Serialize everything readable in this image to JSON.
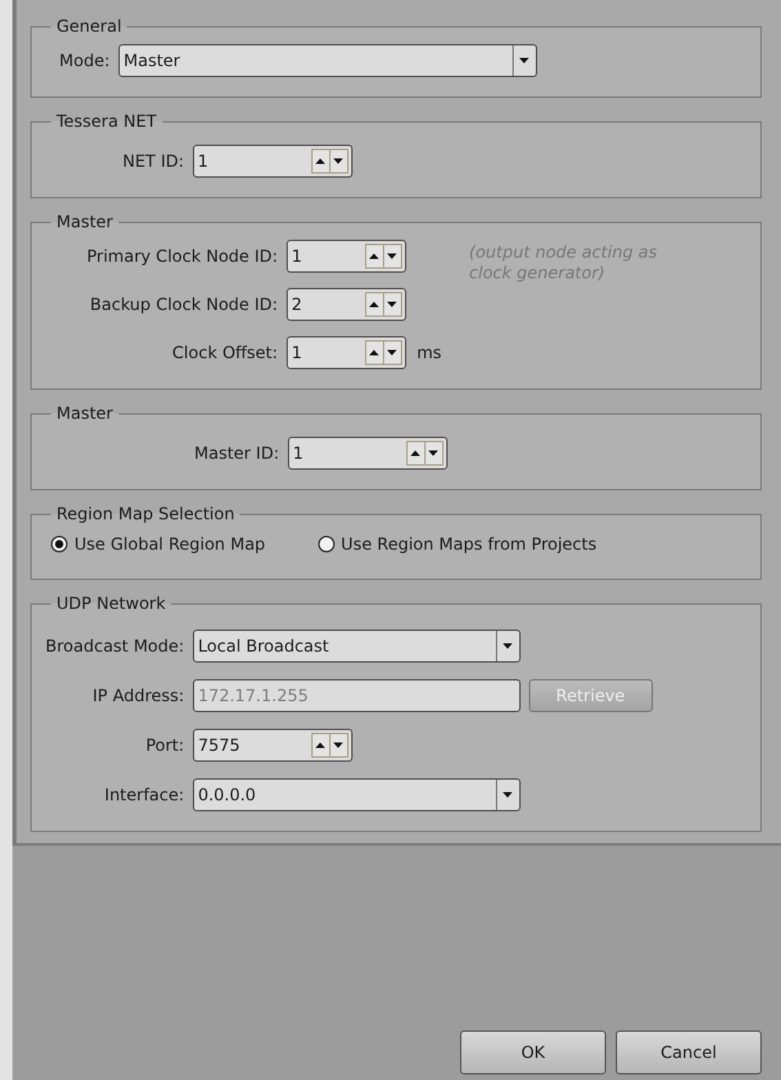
{
  "groups": [
    {
      "title": "General",
      "rows": [
        {
          "kind": "select",
          "label": "Mode:",
          "value": "Master"
        }
      ]
    },
    {
      "title": "Tessera NET",
      "rows": [
        {
          "kind": "spin",
          "label": "NET ID:",
          "value": "1"
        }
      ]
    },
    {
      "title": "Master",
      "note": "(output node acting as clock generator)",
      "rows": [
        {
          "kind": "spin",
          "label": "Primary Clock Node ID:",
          "value": "1"
        },
        {
          "kind": "spin",
          "label": "Backup Clock Node ID:",
          "value": "2"
        },
        {
          "kind": "spin",
          "label": "Clock Offset:",
          "value": "1",
          "unit": "ms"
        }
      ]
    },
    {
      "title": "Master",
      "rows": [
        {
          "kind": "spin",
          "label": "Master ID:",
          "value": "1"
        }
      ]
    },
    {
      "title": "Region Map Selection",
      "radios": [
        {
          "label": "Use Global Region Map",
          "selected": true
        },
        {
          "label": "Use Region Maps from Projects",
          "selected": false
        }
      ]
    },
    {
      "title": "UDP Network",
      "rows": [
        {
          "kind": "select",
          "label": "Broadcast Mode:",
          "value": "Local Broadcast"
        },
        {
          "kind": "text",
          "label": "IP Address:",
          "value": "172.17.1.255",
          "disabled": true,
          "button": {
            "label": "Retrieve",
            "disabled": true
          }
        },
        {
          "kind": "spin",
          "label": "Port:",
          "value": "7575"
        },
        {
          "kind": "select",
          "label": "Interface:",
          "value": "0.0.0.0"
        }
      ]
    }
  ],
  "buttons": [
    "OK",
    "Cancel"
  ]
}
